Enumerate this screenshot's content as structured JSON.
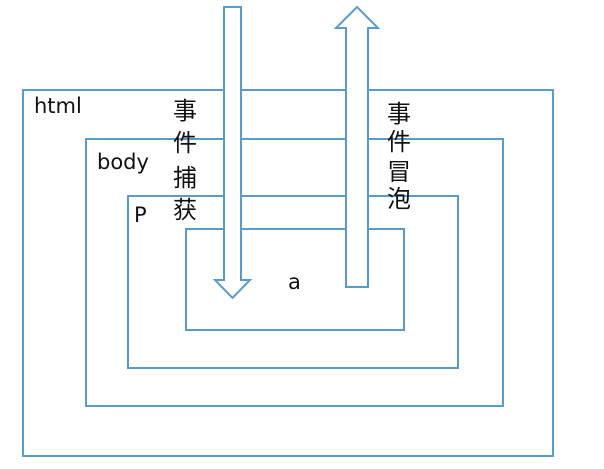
{
  "layers": {
    "html": "html",
    "body": "body",
    "p": "P",
    "a": "a"
  },
  "capture": {
    "label": [
      "事",
      "件",
      "捕",
      "获"
    ],
    "direction": "down"
  },
  "bubble": {
    "label": [
      "事",
      "件",
      "冒",
      "泡"
    ],
    "direction": "up"
  },
  "colors": {
    "stroke": "#5b9bc8",
    "text": "#111111"
  }
}
